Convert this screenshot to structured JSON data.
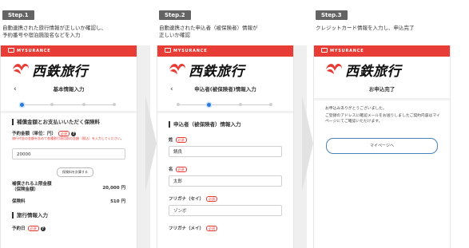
{
  "steps": [
    {
      "badge": "Step.1",
      "description": "自動連携された旅行情報が正しいか確認し、\n予約番号や宿泊施設名などを入力",
      "app_bar": "MYSURANCE",
      "logo": "西鉄旅行",
      "page_title": "基本情報入力",
      "section1": "補償金額とお支払いいただく保険料",
      "amount_label": "予約金額（単位：円）",
      "required": "必須",
      "warning": "旅行代金の金額を含めて各種割引適用前の金額（税込）を入力してください。",
      "amount_value": "20000",
      "calc_button": "保険料を計算する",
      "insured_label": "補償される上限金額\n（保険金額）",
      "insured_value": "20,000 円",
      "premium_label": "保険料",
      "premium_value": "510 円",
      "section2": "旅行情報入力",
      "date_label": "予約日"
    },
    {
      "badge": "Step.2",
      "description": "自動連携された申込者（被保険者）情報が\n正しいか確認",
      "app_bar": "MYSURANCE",
      "logo": "西鉄旅行",
      "page_title": "申込者(被保険者)情報入力",
      "section1": "申込者（被保険者）情報入力",
      "required": "必須",
      "sei_label": "姓",
      "sei_value": "鍋良",
      "mei_label": "名",
      "mei_value": "太郎",
      "sei_kana_label": "フリガナ（セイ）",
      "sei_kana_value": "ゾンボ",
      "mei_kana_label": "フリガナ（メイ）"
    },
    {
      "badge": "Step.3",
      "description": "クレジットカード情報を入力し、申込完了",
      "app_bar": "MYSURANCE",
      "logo": "西鉄旅行",
      "page_title": "お申込完了",
      "message1": "お申込みありがとうございました。",
      "message2": "ご登録のアドレスに確認メールをお送りしましたご契約内容はマイページにてご確認いただけます。",
      "mypage_button": "マイページへ"
    }
  ],
  "colors": {
    "brand_red": "#e83c37",
    "badge_gray": "#646464",
    "step_blue": "#2b7bd8"
  },
  "icons": {
    "logo_mark": "nishitetsu-logo-icon",
    "back": "chevron-left-icon",
    "help": "question-icon"
  }
}
